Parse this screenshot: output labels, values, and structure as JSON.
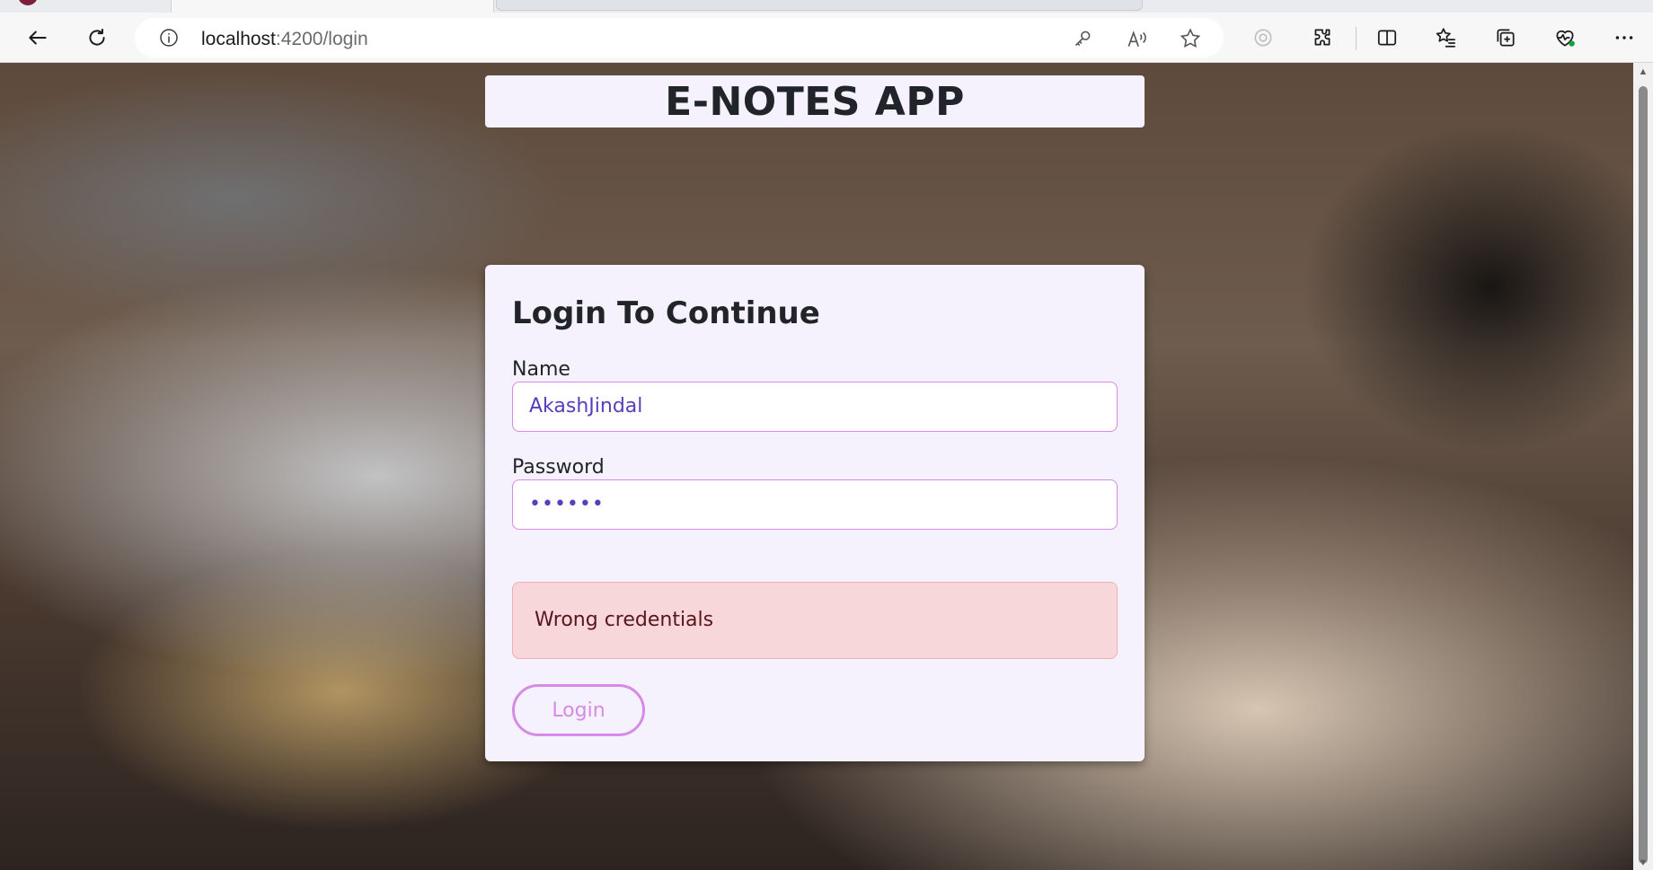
{
  "browser": {
    "url_host": "localhost",
    "url_rest": ":4200/login",
    "icons": {
      "back": "back-arrow-icon",
      "reload": "reload-icon",
      "info": "info-icon",
      "key": "key-icon",
      "read_aloud": "read-aloud-icon",
      "favorite": "star-icon",
      "copilot": "copilot-icon",
      "extensions": "puzzle-icon",
      "split_screen": "split-screen-icon",
      "favorites": "favorites-list-icon",
      "collections": "collections-icon",
      "health": "browser-essentials-icon",
      "more": "more-dots-icon"
    }
  },
  "page": {
    "header_title": "E-NOTES APP",
    "login": {
      "title": "Login To Continue",
      "name_label": "Name",
      "name_value": "AkashJindal",
      "password_label": "Password",
      "password_value": "••••••",
      "error_message": "Wrong credentials",
      "login_button": "Login"
    }
  },
  "colors": {
    "card_bg": "#f5f1fd",
    "accent": "#d68be6",
    "input_text": "#5a3dbb",
    "alert_bg": "#f8d7da",
    "alert_text": "#58151c"
  }
}
